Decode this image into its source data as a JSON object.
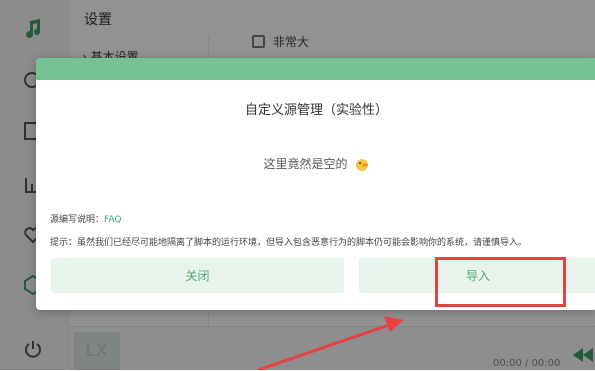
{
  "app": {
    "page_title": "设置",
    "sub_nav_item": "基本设置",
    "checkbox_label": "非常大",
    "cover_text": "LX",
    "time": "00:00 / 00:00"
  },
  "sidebar": {
    "icons": [
      "music-note-icon",
      "search-icon",
      "image-list-icon",
      "chart-icon",
      "heart-icon",
      "settings-icon",
      "power-icon"
    ]
  },
  "dialog": {
    "title": "自定义源管理（实验性）",
    "empty_text": "这里竟然是空的",
    "source_note_label": "源编写说明：",
    "faq_link": "FAQ",
    "tip": "提示：虽然我们已经尽可能地隔离了脚本的运行环境，但导入包含恶意行为的脚本仍可能会影响你的系统，请谨慎导入。",
    "close_button": "关闭",
    "import_button": "导入"
  },
  "colors": {
    "accent": "#74c396",
    "button_bg": "#e8f3ec",
    "button_text": "#4aa96f",
    "annotation": "#e84141"
  }
}
